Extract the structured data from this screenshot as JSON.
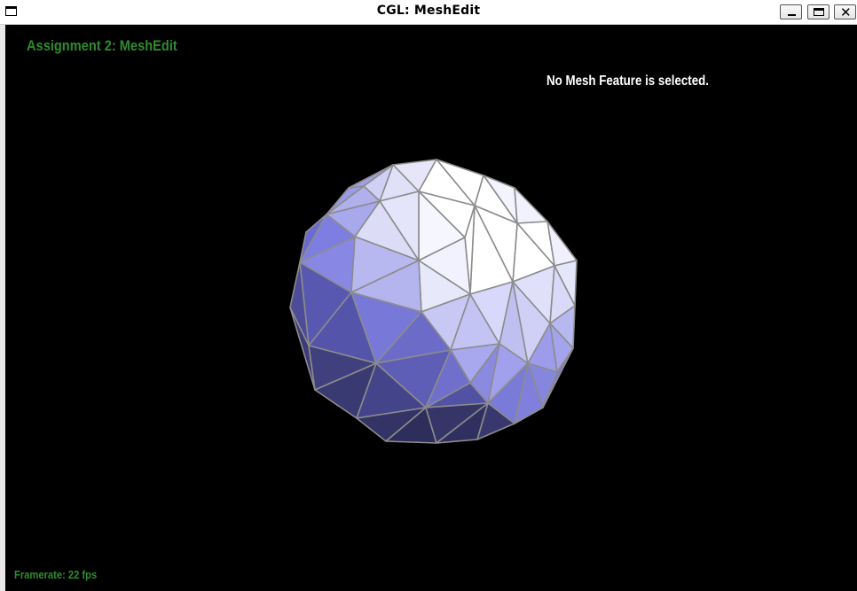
{
  "window": {
    "title": "CGL: MeshEdit"
  },
  "overlay": {
    "assignment_title": "Assignment 2: MeshEdit",
    "selection_status": "No Mesh Feature is selected.",
    "framerate": "Framerate: 22 fps"
  },
  "colors": {
    "overlay_green": "#2e8b2e",
    "background": "#000000",
    "mesh_edge": "#8c8c8c",
    "mesh_light": "#ffffff",
    "mesh_mid": "#8c8ce6",
    "mesh_dark": "#2a2a48"
  },
  "icons": {
    "system_menu": "window-menu-icon",
    "minimize": "minimize-icon",
    "maximize": "maximize-icon",
    "close": "close-icon"
  }
}
